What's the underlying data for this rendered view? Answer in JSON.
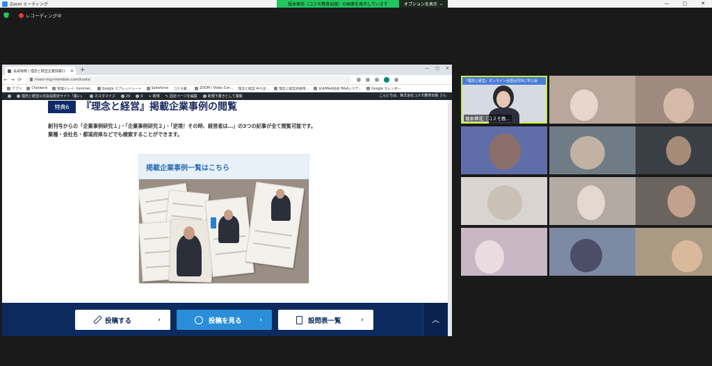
{
  "zoom": {
    "title": "Zoom ミーティング",
    "share_banner": "堀本華花（コスモ教育出版）の画面を表示しています",
    "options_button": "オプションを表示",
    "recording_label": "レコーディング中",
    "window_controls": [
      "—",
      "▢",
      "✕"
    ]
  },
  "browser": {
    "tab_title": "会員特典 | 理念と経営企業情報口",
    "url": "rinen-mg-member.com/tools/",
    "bookmarks": [
      "アプリ",
      "Chatwork",
      "管理ドレイ- hommat..",
      "Google スプレッドシート",
      "Salesforce",
      "コスモ書...",
      "ZOOM / Video Con...",
      "理念と経営 中小企...",
      "理念と経営会員情...",
      "日本M&A協会 M&Aシステ...",
      "Google カレンダー"
    ],
    "adminbar": {
      "items": [
        "理念と経営公式会員限定サイト「集い」",
        "カスタマイズ",
        "29",
        "0",
        "新規",
        "固定ページを編集",
        "新規下書きとして複製"
      ],
      "greeting": "こんにちは、株式会社コスモ教育出版 さん"
    }
  },
  "page": {
    "badge": "特典6",
    "heading": "『理念と経営』掲載企業事例の閲覧",
    "desc_line1": "創刊号からの「企業事例研究１」・「企業事例研究２」・「逆境！その時、経営者は…」の3つの記事が全て閲覧可能です。",
    "desc_line2": "業種・会社名・都道府県などでも検索することができます。",
    "card_header": "掲載企業事例一覧はこちら",
    "buttons": [
      {
        "label": "投稿する",
        "icon": "pencil-icon"
      },
      {
        "label": "投稿を見る",
        "icon": "chat-icon"
      },
      {
        "label": "設問表一覧",
        "icon": "document-icon"
      }
    ],
    "chevron": "›",
    "up": "︿"
  },
  "gallery": {
    "presenter_name": "堀本華花（コスモ教...",
    "presenter_slide": "『理念と経営』オンライン全国合同共に学ぶ会"
  }
}
